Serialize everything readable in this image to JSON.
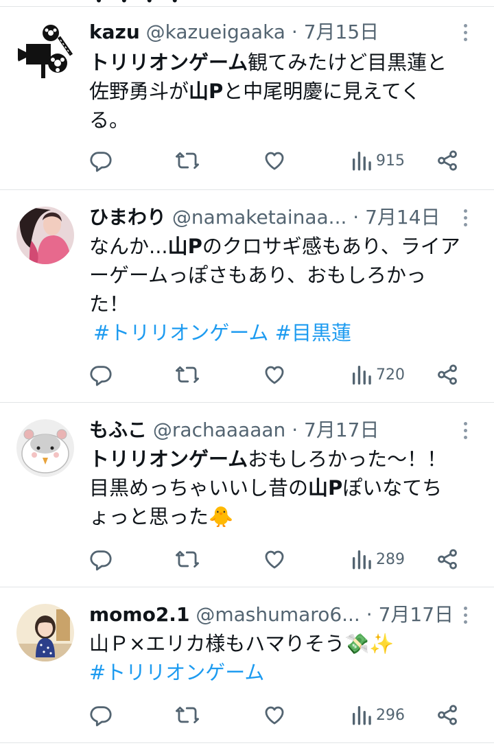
{
  "tweets": [
    {
      "name": "kazu",
      "handle": "@kazueigaaka",
      "dot": "·",
      "date": "7月15日",
      "body_parts": {
        "p1": "トリリオンゲーム",
        "p2": "観てみたけど目黒蓮と",
        "p3": "佐野勇斗が",
        "p4": "山P",
        "p5": "と中尾明慶に見えてく",
        "p6": "る。"
      },
      "views": "915",
      "avatar": "film-projector-avatar"
    },
    {
      "name": "ひまわり",
      "handle": "@namaketainaa...",
      "dot": "·",
      "date": "7月14日",
      "body_parts": {
        "p1": "なんか...",
        "p2": "山P",
        "p3": "のクロサギ感もあり、ライア",
        "p4": "ーゲームっぽさもあり、おもしろかっ",
        "p5": "た！"
      },
      "hashtags": [
        "#トリリオンゲーム",
        "#目黒蓮"
      ],
      "views": "720",
      "avatar": "woman-in-pink-avatar"
    },
    {
      "name": "もふこ",
      "handle": "@rachaaaaan",
      "dot": "·",
      "date": "7月17日",
      "body_parts": {
        "p1": "トリリオンゲーム",
        "p2": "おもしろかった〜！！",
        "p3": "目黒めっちゃいいし昔の",
        "p4": "山P",
        "p5": "ぽいなてち",
        "p6": "ょっと思った🐥"
      },
      "views": "289",
      "avatar": "hamster-avatar"
    },
    {
      "name": "momo2.1",
      "handle": "@mashumaro6...",
      "dot": "·",
      "date": "7月17日",
      "body_parts": {
        "p1": "山Ｐ×エリカ様もハマりそう💸✨"
      },
      "hashtags": [
        "#トリリオンゲーム"
      ],
      "views": "296",
      "avatar": "girl-illustration-avatar"
    }
  ],
  "colors": {
    "text": "#0f1419",
    "secondary": "#536471",
    "link": "#1d9bf0",
    "icon": "#536471",
    "divider": "#e1e4e6"
  },
  "icons": [
    "reply-icon",
    "retweet-icon",
    "like-icon",
    "views-icon",
    "share-icon",
    "more-icon"
  ]
}
